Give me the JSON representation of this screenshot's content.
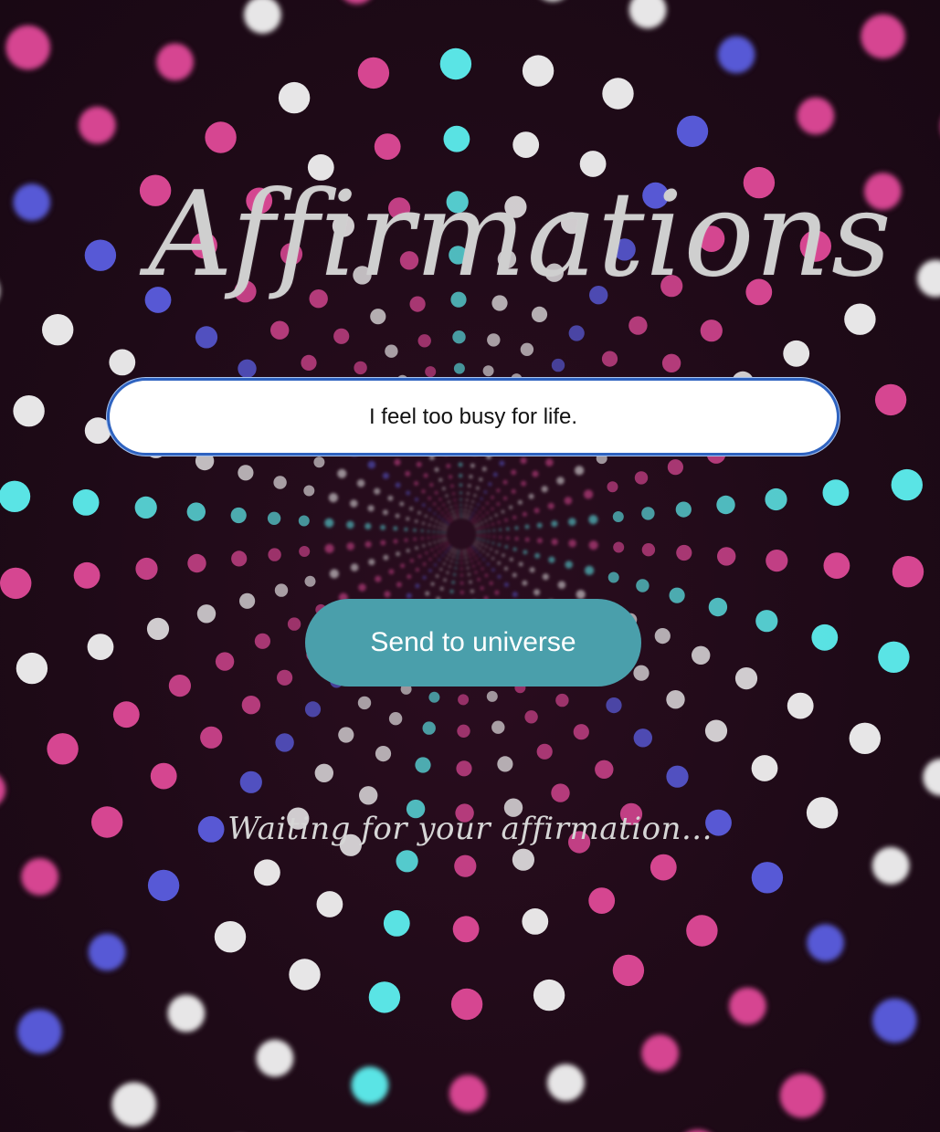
{
  "app": {
    "title": "Affirmations"
  },
  "input": {
    "value": "I feel too busy for life.",
    "placeholder": ""
  },
  "send_button": {
    "label": "Send to universe"
  },
  "status": {
    "text": "Waiting for your affirmation..."
  },
  "colors": {
    "background": "#1e0a17",
    "button": "#4a9fab",
    "input_border": "#2f63c0",
    "title_text": "#cfcfcf",
    "dot_pink": "#e04a98",
    "dot_blue": "#5b5ee0",
    "dot_cyan": "#5ef0f0",
    "dot_white": "#f2f2f2"
  }
}
